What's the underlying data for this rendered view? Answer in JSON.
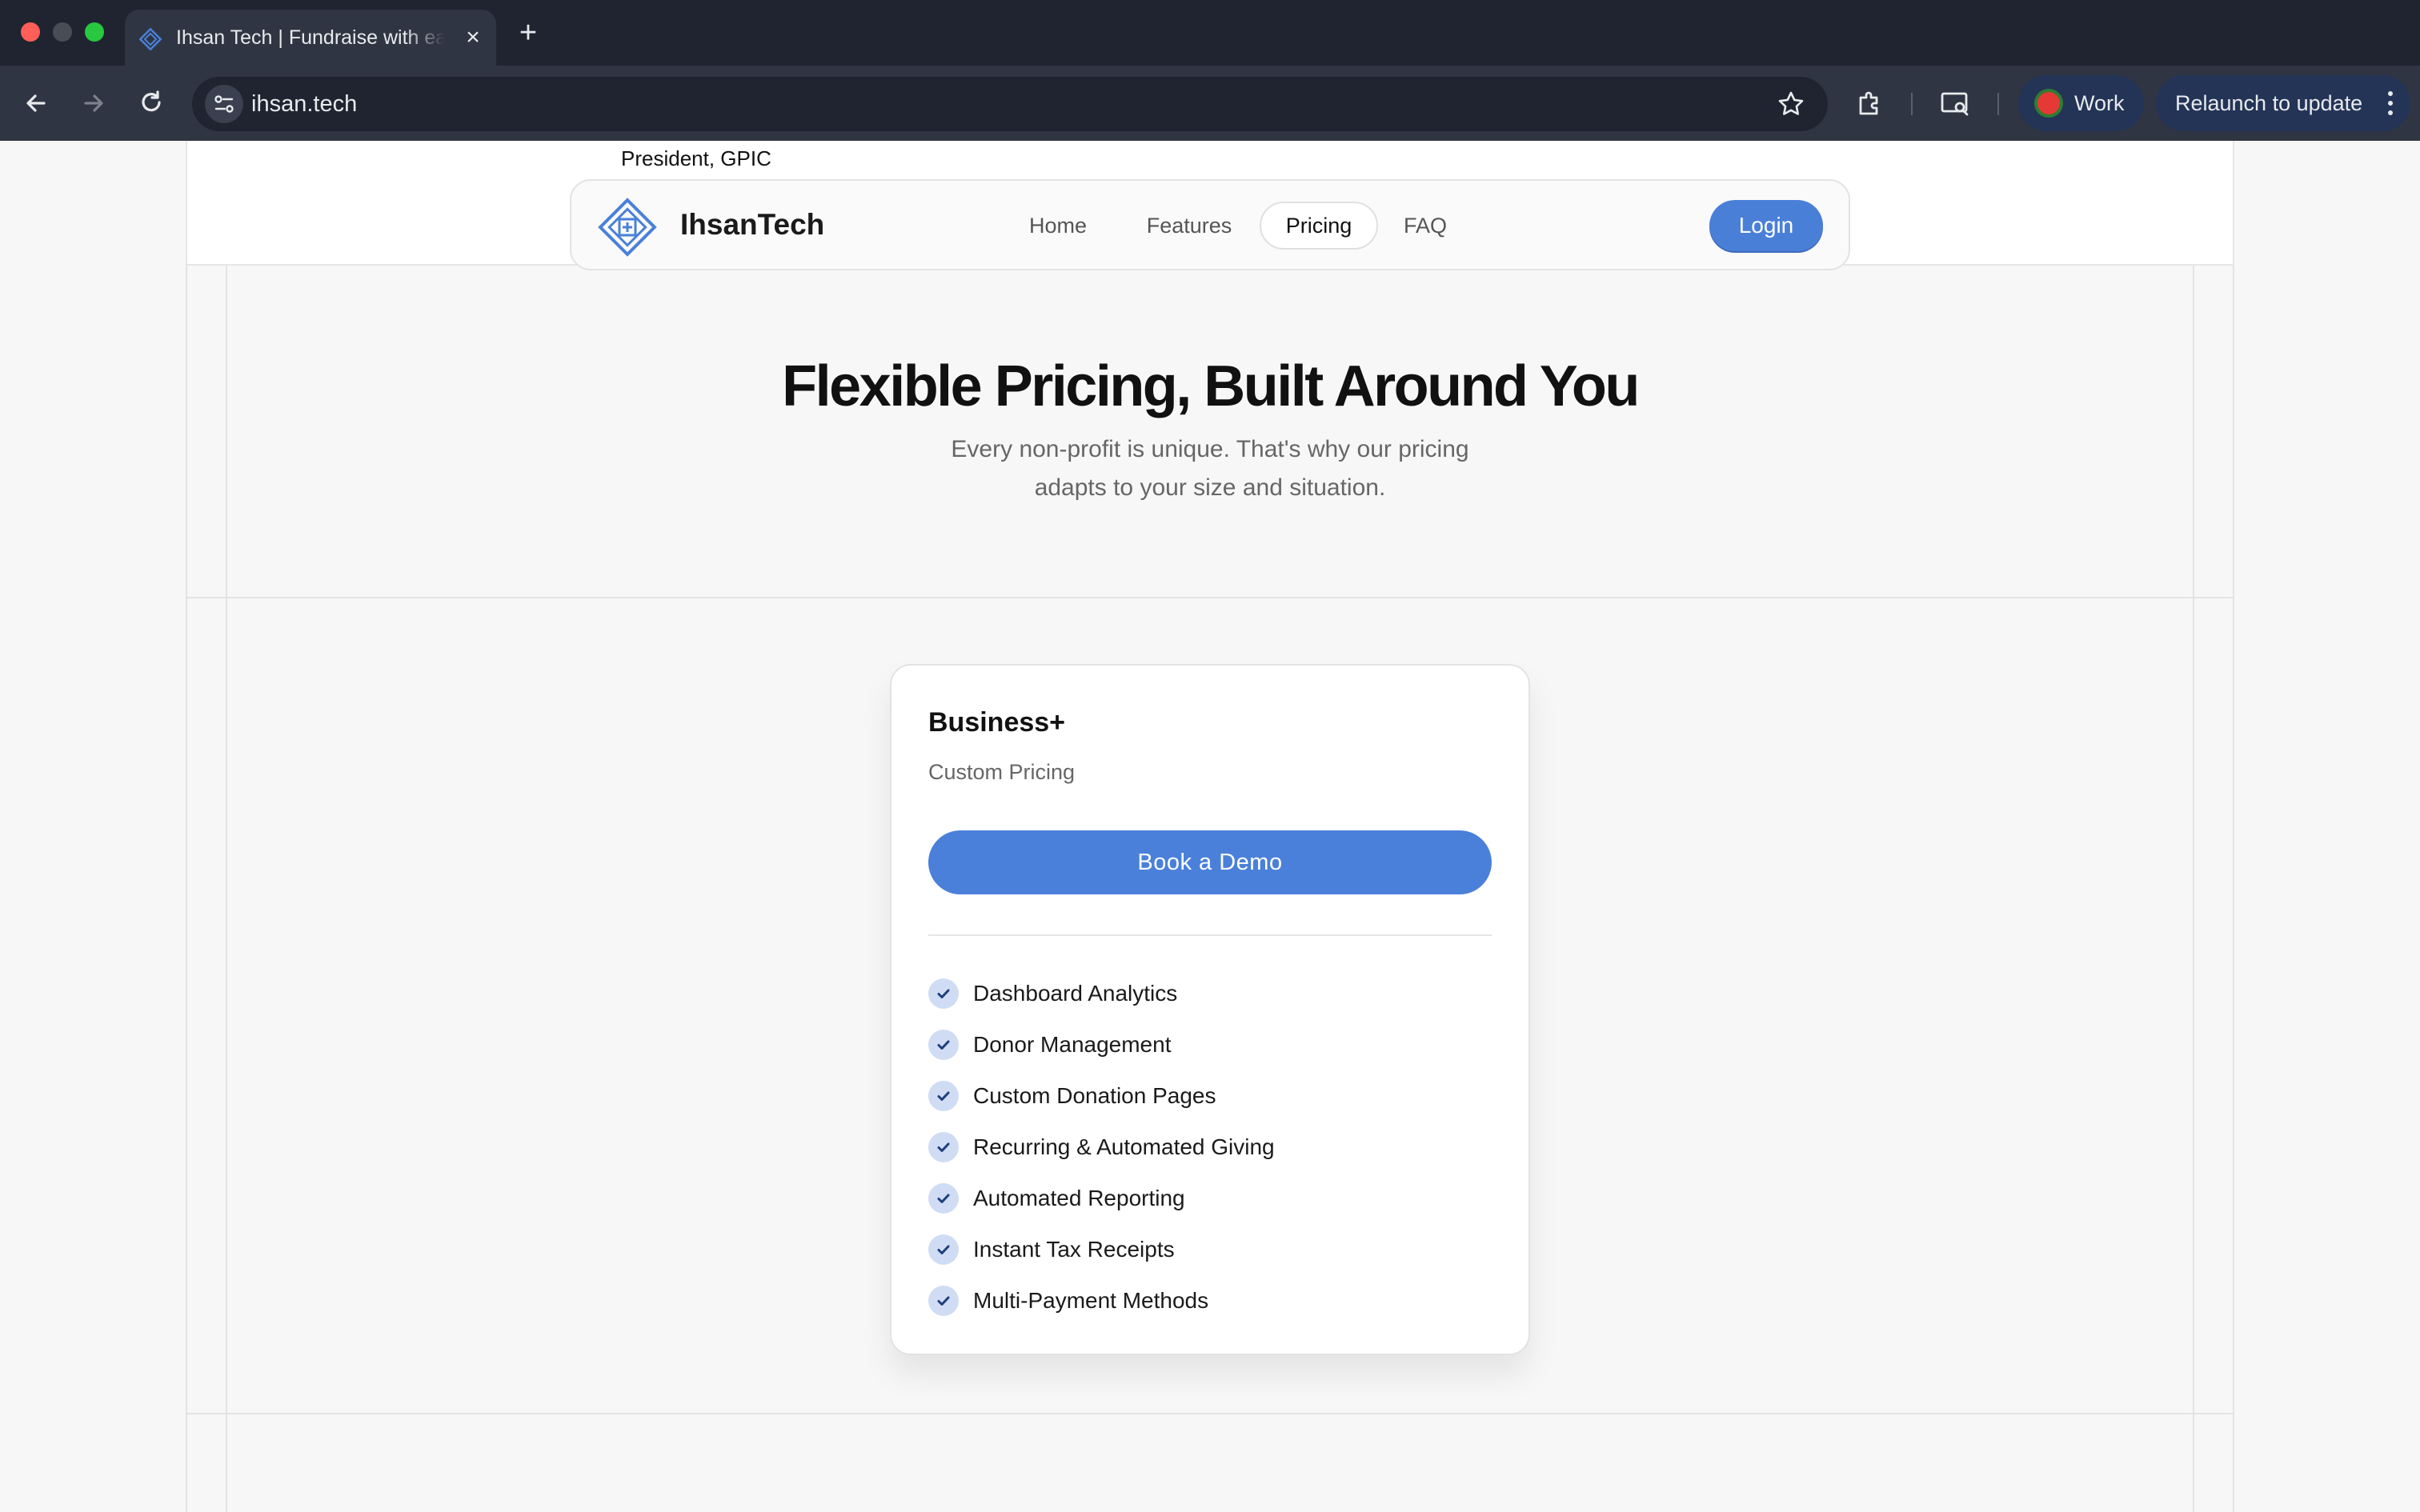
{
  "browser": {
    "tab_title": "Ihsan Tech | Fundraise with ease",
    "url": "ihsan.tech",
    "profile_label": "Work",
    "relaunch_label": "Relaunch to update"
  },
  "page": {
    "testimonial_caption": "President, GPIC",
    "brand": "IhsanTech",
    "nav": {
      "home": "Home",
      "features": "Features",
      "pricing": "Pricing",
      "faq": "FAQ",
      "login": "Login"
    },
    "hero": {
      "title": "Flexible Pricing, Built Around You",
      "subtitle": "Every non-profit is unique. That's why our pricing adapts to your size and situation."
    },
    "plan": {
      "name": "Business+",
      "price": "Custom Pricing",
      "cta": "Book a Demo",
      "features": [
        "Dashboard Analytics",
        "Donor Management",
        "Custom Donation Pages",
        "Recurring & Automated Giving",
        "Automated Reporting",
        "Instant Tax Receipts",
        "Multi-Payment Methods"
      ]
    },
    "colors": {
      "accent": "#4a80d9",
      "check_bg": "#cfdcf4"
    }
  }
}
